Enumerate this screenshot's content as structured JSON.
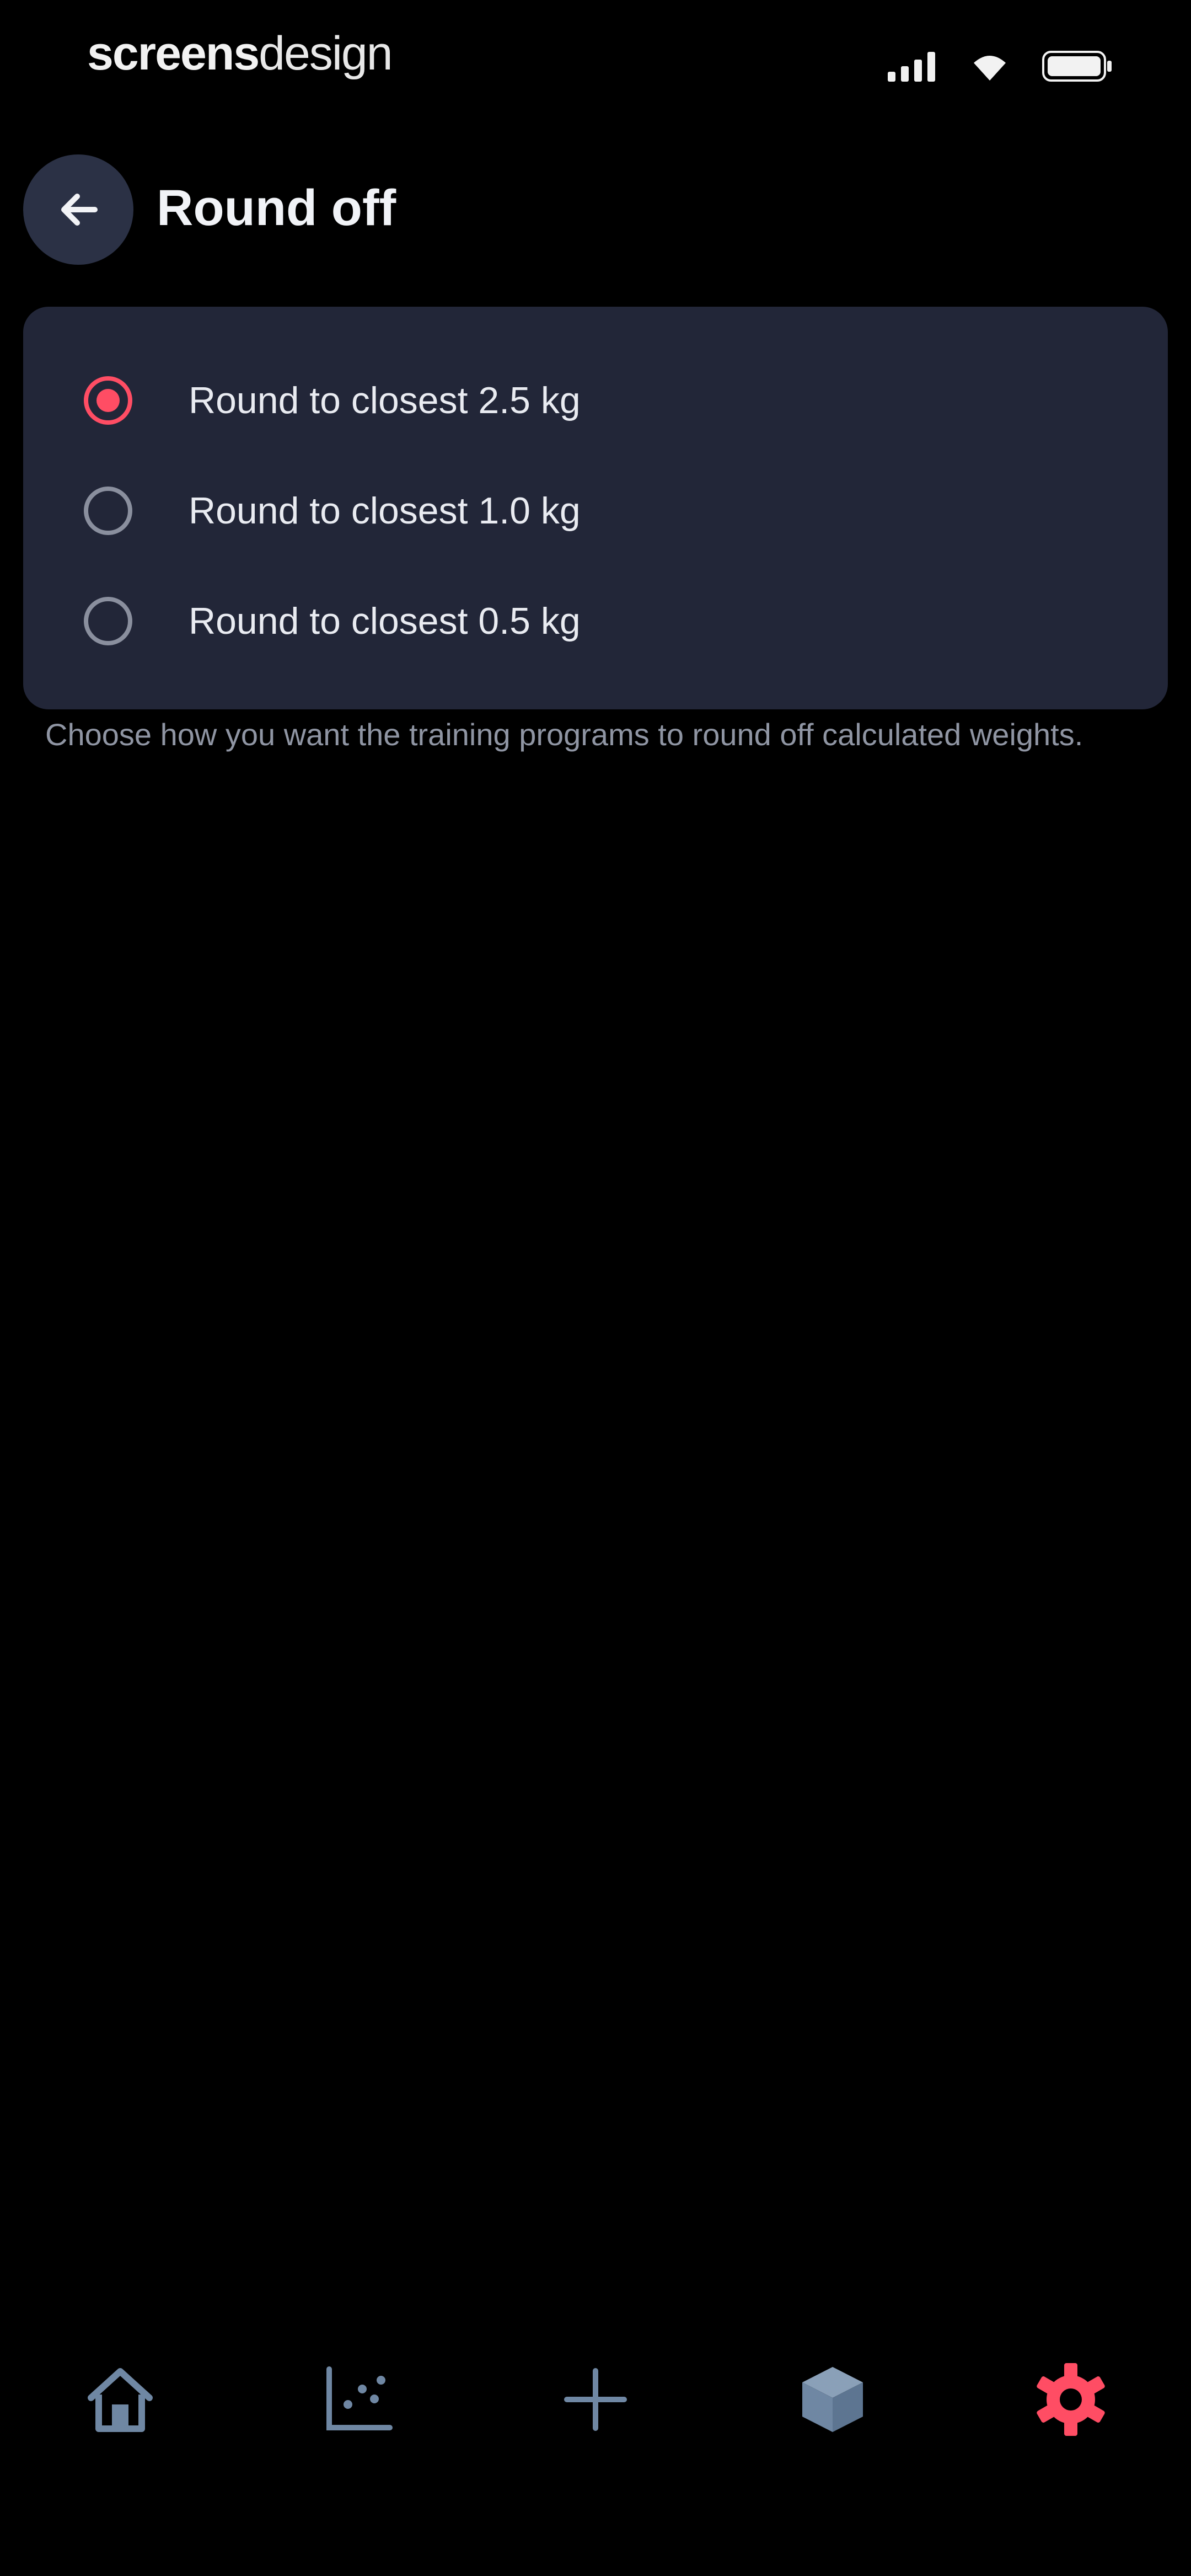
{
  "status_bar": {
    "watermark_bold": "screens",
    "watermark_light": "design",
    "icons": [
      "signal-icon",
      "wifi-icon",
      "battery-icon"
    ]
  },
  "header": {
    "back_icon": "arrow-left-icon",
    "title": "Round off"
  },
  "options": [
    {
      "label": "Round to closest 2.5 kg",
      "selected": true
    },
    {
      "label": "Round to closest 1.0 kg",
      "selected": false
    },
    {
      "label": "Round to closest 0.5 kg",
      "selected": false
    }
  ],
  "helper_text": "Choose how you want the training programs to round off calculated weights.",
  "bottom_nav": {
    "items": [
      {
        "icon": "home-icon",
        "active": false
      },
      {
        "icon": "chart-icon",
        "active": false
      },
      {
        "icon": "plus-icon",
        "active": false
      },
      {
        "icon": "cube-icon",
        "active": false
      },
      {
        "icon": "gear-icon",
        "active": true
      }
    ]
  },
  "colors": {
    "accent": "#ff4d64",
    "card": "#222638",
    "background": "#000000",
    "inactive_icon": "#6f87a3"
  }
}
